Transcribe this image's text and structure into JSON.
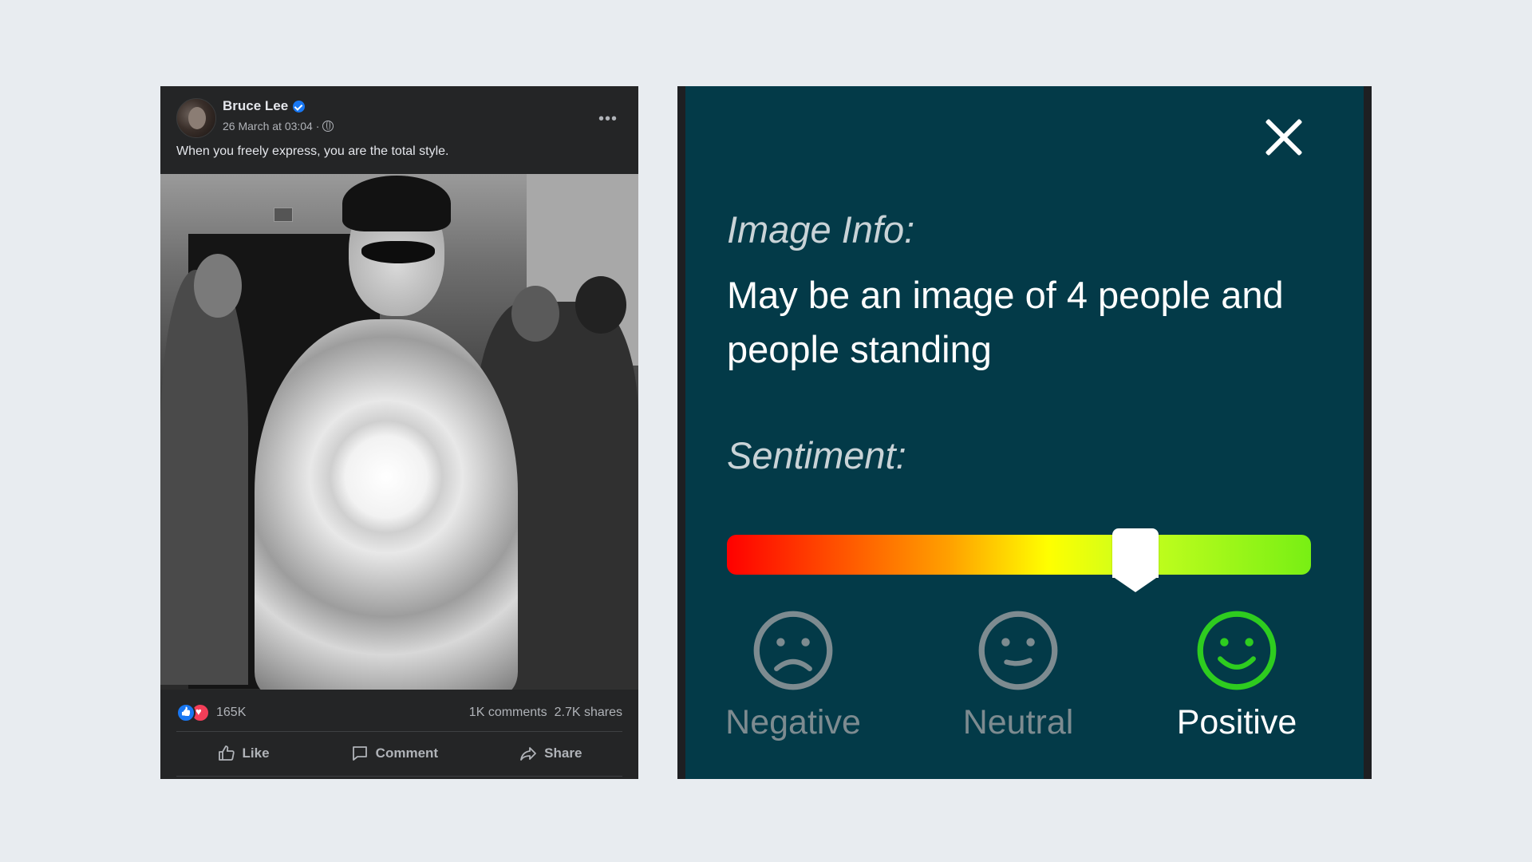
{
  "post": {
    "author": "Bruce Lee",
    "meta": "26 March at 03:04 ·",
    "caption": "When you freely express, you are the total style.",
    "reaction_count": "165K",
    "comments": "1K comments",
    "shares": "2.7K shares",
    "actions": {
      "like": "Like",
      "comment": "Comment",
      "share": "Share"
    },
    "icons": {
      "verified": "verified-badge-icon",
      "privacy": "globe-icon",
      "more": "more-options-icon",
      "reactions": [
        "like-reaction-icon",
        "love-reaction-icon"
      ]
    }
  },
  "panel": {
    "info_label": "Image Info:",
    "info_text": "May be an image of 4 people and people standing",
    "sentiment_label": "Sentiment:",
    "sentiment_value": 0.7,
    "sentiment_gradient": [
      "#ff0000",
      "#ffa000",
      "#ffff00",
      "#78ef14"
    ],
    "options": [
      {
        "label": "Negative",
        "icon": "sad-face-icon",
        "active": false
      },
      {
        "label": "Neutral",
        "icon": "neutral-face-icon",
        "active": false
      },
      {
        "label": "Positive",
        "icon": "smiley-face-icon",
        "active": true
      }
    ],
    "colors": {
      "background": "#033a48",
      "inactive": "#7d8b90",
      "active_icon": "#2ecc1f"
    }
  }
}
